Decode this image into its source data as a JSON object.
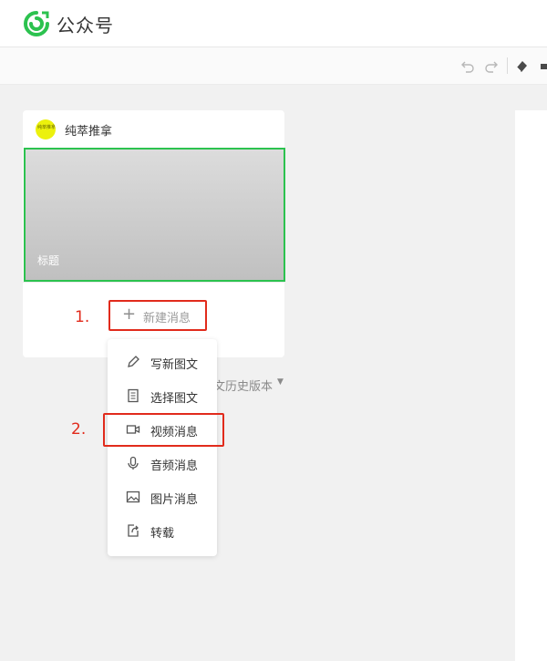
{
  "header": {
    "app_title": "公众号",
    "logo_icon": "wechat-mp-logo-icon",
    "brand_color": "#2cc24f"
  },
  "toolbar": {
    "icons": [
      "undo-icon",
      "redo-icon",
      "eraser-icon"
    ]
  },
  "card": {
    "account_name": "纯萃推拿",
    "avatar_text": "纯萃推拿",
    "cover_title": "标题",
    "new_message_label": "新建消息"
  },
  "annotations": {
    "step1": "1.",
    "step2": "2.",
    "color": "#e12b1c"
  },
  "history_link": {
    "label": "文历史版本"
  },
  "menu": {
    "items": [
      {
        "label": "写新图文",
        "icon": "pencil-icon"
      },
      {
        "label": "选择图文",
        "icon": "document-icon"
      },
      {
        "label": "视频消息",
        "icon": "video-camera-icon"
      },
      {
        "label": "音频消息",
        "icon": "microphone-icon"
      },
      {
        "label": "图片消息",
        "icon": "image-icon"
      },
      {
        "label": "转载",
        "icon": "share-icon"
      }
    ]
  }
}
